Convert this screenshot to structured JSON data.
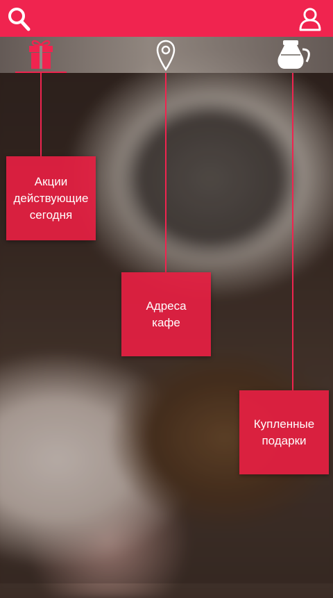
{
  "header": {
    "search_icon": "search-icon",
    "profile_icon": "user-icon",
    "accent_color": "#f0244f"
  },
  "tabs": [
    {
      "icon": "gift-icon",
      "active": true
    },
    {
      "icon": "location-pin-icon",
      "active": false
    },
    {
      "icon": "coffee-pot-icon",
      "active": false
    }
  ],
  "cards": {
    "promos": "Акции\nдействующие\nсегодня",
    "addresses": "Адреса\nкафе",
    "gifts": "Купленные\nподарки"
  }
}
